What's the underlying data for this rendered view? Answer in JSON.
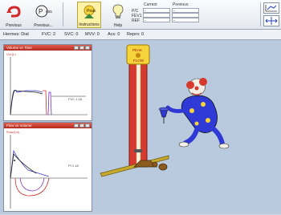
{
  "toolbar": {
    "previous_label": "Previous",
    "previous_alt_label": "Previous...",
    "instructions_label": "Instructions",
    "help_label": "Help"
  },
  "info": {
    "current_header": "Current",
    "previous_header": "Previous",
    "row1_label": "P/C",
    "row2_label": "FEV1",
    "row3_label": "REF",
    "row1_current": "-",
    "row1_previous": "-",
    "row3_current": "-",
    "row3_previous": "-"
  },
  "status": {
    "item1": "Hermes: Dial",
    "item2": "FVC: 2",
    "item3": "SVC: 0",
    "item4": "MVV: 0",
    "item5": "Acs: 0",
    "item6": "Repro: 0"
  },
  "panels": {
    "top_title": "Volume vs Time",
    "top_ylabel": "Vol.(L)",
    "top_annotation": "FVC 1.18",
    "bottom_title": "Flow vs Volume",
    "bottom_ylabel": "Flow(L/s)",
    "bottom_annotation": "PI 1.18"
  },
  "game": {
    "bell_text": "PEAK",
    "bell_subtext": "FLOW"
  },
  "colors": {
    "accent_red": "#d23b2c",
    "toolbar_bg": "#eef1f6",
    "canvas_bg": "#b9c9de",
    "clown_blue": "#2f39d6"
  },
  "icons": [
    "undo-arrow-icon",
    "previous-icon",
    "instructions-icon",
    "help-bulb-icon",
    "auto-scale-icon",
    "zoom-arrows-icon"
  ]
}
